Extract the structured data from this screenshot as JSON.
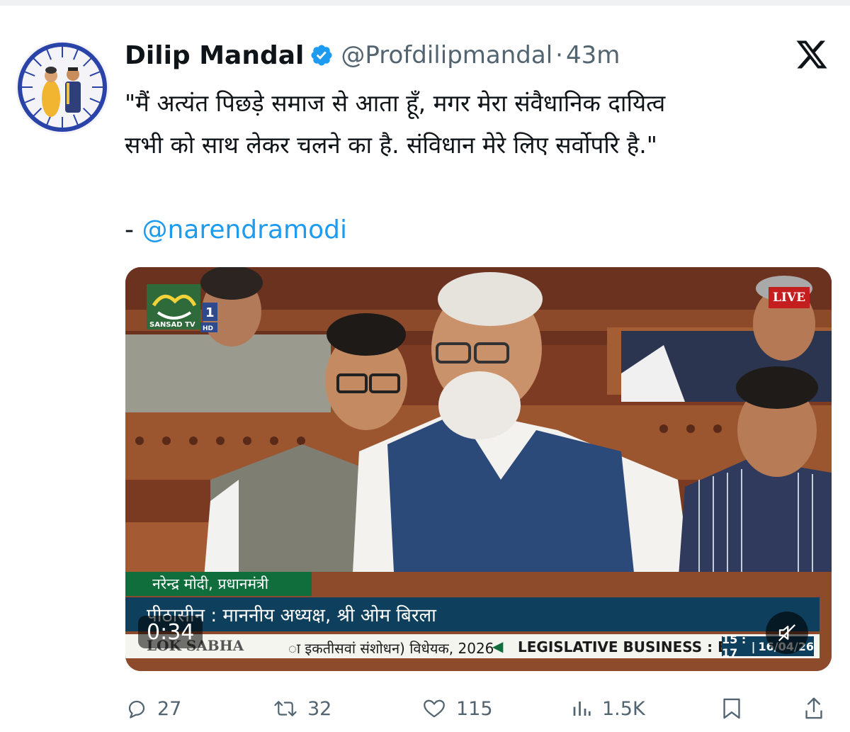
{
  "author": {
    "display_name": "Dilip Mandal",
    "handle": "@Profdilipmandal",
    "separator": "·",
    "timestamp": "43m",
    "verified": true
  },
  "tweet": {
    "lines": [
      "\"मैं अत्यंत पिछड़े समाज से आता हूँ, मगर मेरा संवैधानिक दायित्व",
      "सभी को साथ लेकर चलने का है. संविधान मेरे लिए सर्वोपरि है.\""
    ],
    "attribution_dash": "-",
    "mention": "@narendramodi"
  },
  "video": {
    "channel": {
      "name": "SANSAD TV",
      "number": "1",
      "quality": "HD"
    },
    "live_label": "LIVE",
    "speaker_caption": "नरेन्द्र मोदी, प्रधानमंत्री",
    "chair_caption": "पीठासीन : माननीय अध्यक्ष, श्री ओम बिरला",
    "ticker_label": "LOK SABHA",
    "ticker_text": "ा इकतीसवां संशोधन) विधेयक, 2026",
    "ticker_arrow": "◀",
    "ticker_business": "LEGISLATIVE BUSINESS : E",
    "clock_time": "15 : 17",
    "clock_date": "16/04/26",
    "elapsed": "0:34",
    "muted": true
  },
  "actions": {
    "replies": "27",
    "reposts": "32",
    "likes": "115",
    "views": "1.5K"
  },
  "icons": {
    "verified": "verified-badge-icon",
    "platform": "x-logo-icon",
    "reply": "reply-icon",
    "repost": "repost-icon",
    "like": "heart-icon",
    "views": "views-chart-icon",
    "bookmark": "bookmark-icon",
    "share": "share-icon",
    "mute": "muted-speaker-icon"
  },
  "colors": {
    "link": "#1d9bf0",
    "secondary_text": "#536471",
    "live": "#c41e1e",
    "caption_green": "#0f6e3b",
    "caption_blue": "#0e3f5c"
  }
}
